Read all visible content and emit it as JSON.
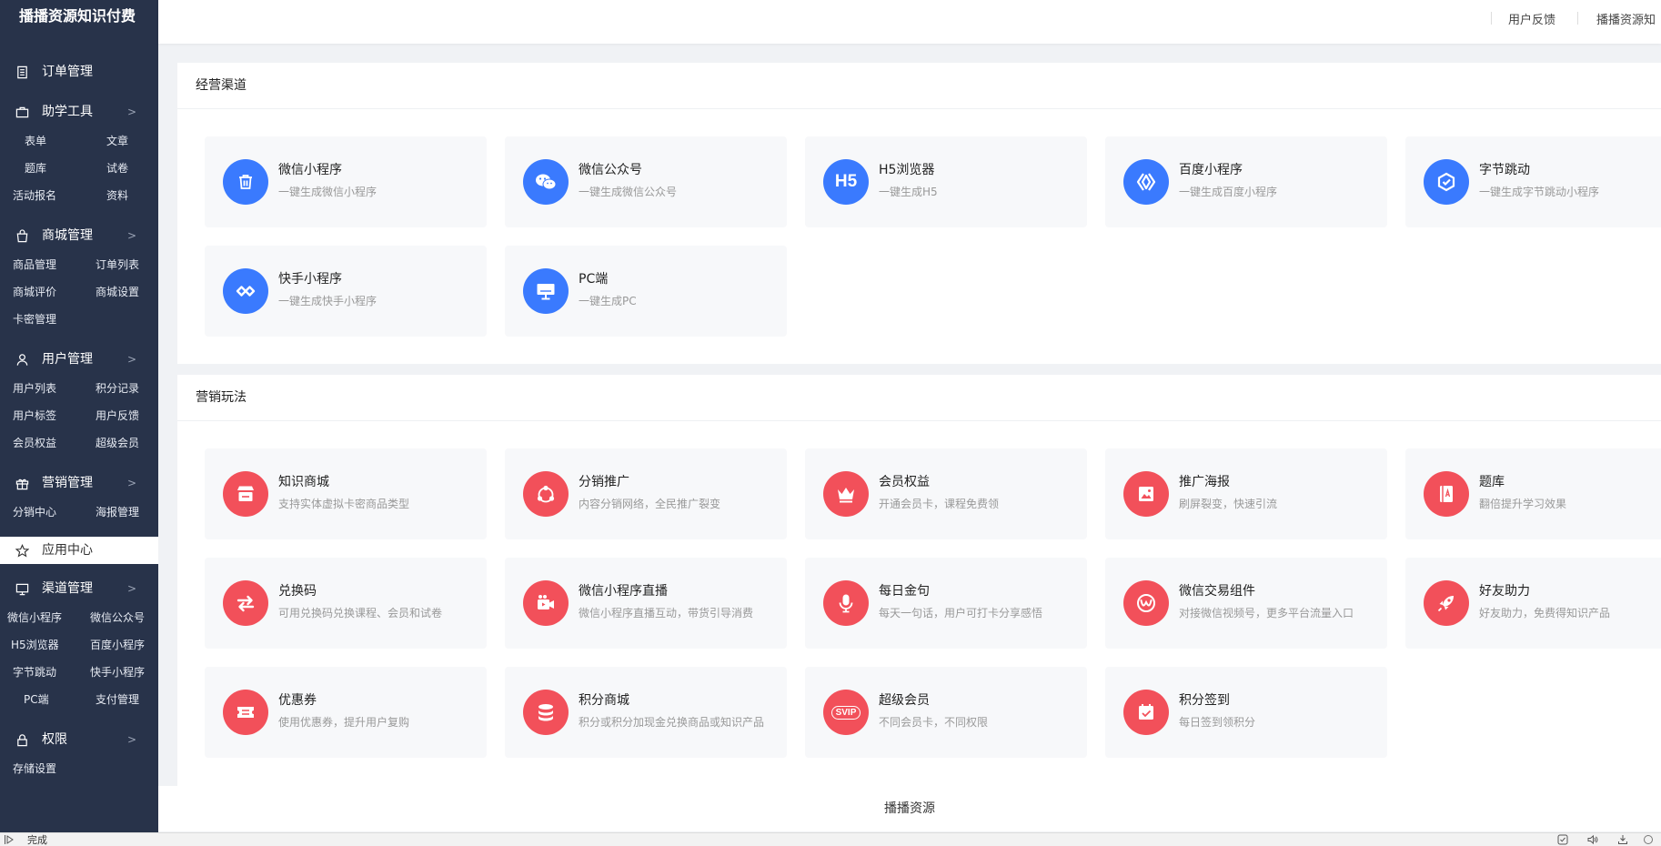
{
  "sidebar": {
    "brand": "播播资源知识付费",
    "order": "订单管理",
    "study": {
      "label": "助学工具",
      "items": [
        "表单",
        "文章",
        "题库",
        "试卷",
        "活动报名",
        "资料"
      ]
    },
    "mall": {
      "label": "商城管理",
      "items": [
        "商品管理",
        "订单列表",
        "商城评价",
        "商城设置",
        "卡密管理"
      ]
    },
    "user": {
      "label": "用户管理",
      "items": [
        "用户列表",
        "积分记录",
        "用户标签",
        "用户反馈",
        "会员权益",
        "超级会员"
      ]
    },
    "marketing": {
      "label": "营销管理",
      "items": [
        "分销中心",
        "海报管理"
      ]
    },
    "app_center": "应用中心",
    "channel": {
      "label": "渠道管理",
      "items": [
        "微信小程序",
        "微信公众号",
        "H5浏览器",
        "百度小程序",
        "字节跳动",
        "快手小程序",
        "PC端",
        "支付管理"
      ]
    },
    "permission": {
      "label": "权限",
      "items": [
        "存储设置"
      ]
    }
  },
  "header": {
    "feedback": "用户反馈",
    "account": "播播资源知"
  },
  "channels": {
    "title": "经营渠道",
    "items": [
      {
        "title": "微信小程序",
        "desc": "一键生成微信小程序",
        "icon": "trash-icon"
      },
      {
        "title": "微信公众号",
        "desc": "一键生成微信公众号",
        "icon": "wechat-icon"
      },
      {
        "title": "H5浏览器",
        "desc": "一键生成H5",
        "icon": "h5-icon",
        "glyph": "H5"
      },
      {
        "title": "百度小程序",
        "desc": "一键生成百度小程序",
        "icon": "baidu-icon"
      },
      {
        "title": "字节跳动",
        "desc": "一键生成字节跳动小程序",
        "icon": "bytedance-icon"
      },
      {
        "title": "快手小程序",
        "desc": "一键生成快手小程序",
        "icon": "kuaishou-icon"
      },
      {
        "title": "PC端",
        "desc": "一键生成PC",
        "icon": "monitor-icon"
      }
    ]
  },
  "marketing": {
    "title": "营销玩法",
    "items": [
      {
        "title": "知识商城",
        "desc": "支持实体虚拟卡密商品类型",
        "icon": "store-icon"
      },
      {
        "title": "分销推广",
        "desc": "内容分销网络，全民推广裂变",
        "icon": "share-icon"
      },
      {
        "title": "会员权益",
        "desc": "开通会员卡，课程免费领",
        "icon": "crown-icon"
      },
      {
        "title": "推广海报",
        "desc": "刷屏裂变，快速引流",
        "icon": "poster-icon"
      },
      {
        "title": "题库",
        "desc": "翻倍提升学习效果",
        "icon": "question-bank-icon"
      },
      {
        "title": "兑换码",
        "desc": "可用兑换码兑换课程、会员和试卷",
        "icon": "exchange-icon"
      },
      {
        "title": "微信小程序直播",
        "desc": "微信小程序直播互动，带货引导消费",
        "icon": "live-camera-icon"
      },
      {
        "title": "每日金句",
        "desc": "每天一句话，用户可打卡分享感悟",
        "icon": "microphone-icon"
      },
      {
        "title": "微信交易组件",
        "desc": "对接微信视频号，更多平台流量入口",
        "icon": "trade-component-icon"
      },
      {
        "title": "好友助力",
        "desc": "好友助力，免费得知识产品",
        "icon": "rocket-icon"
      },
      {
        "title": "优惠券",
        "desc": "使用优惠券，提升用户复购",
        "icon": "coupon-icon"
      },
      {
        "title": "积分商城",
        "desc": "积分或积分加现金兑换商品或知识产品",
        "icon": "coins-icon"
      },
      {
        "title": "超级会员",
        "desc": "不同会员卡，不同权限",
        "icon": "svip-icon",
        "glyph": "SVIP"
      },
      {
        "title": "积分签到",
        "desc": "每日签到领积分",
        "icon": "calendar-check-icon"
      }
    ]
  },
  "footer": "播播资源",
  "status": "完成",
  "colors": {
    "sidebar": "#28334a",
    "blue": "#3a7afe",
    "red": "#f2505a"
  }
}
